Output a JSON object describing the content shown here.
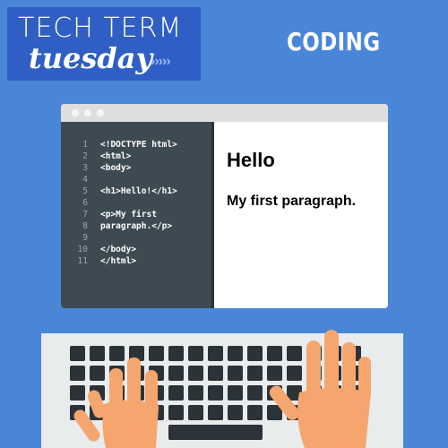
{
  "badge": {
    "line1": "TECH TERM",
    "line2": "tuesday",
    "arrows": "›››››"
  },
  "topic": "CODING",
  "window": {
    "code_lines": [
      {
        "num": "1",
        "text": "<!DOCTYPE html>"
      },
      {
        "num": "2",
        "text": "<html>"
      },
      {
        "num": "3",
        "text": "<body>"
      },
      {
        "num": "4",
        "text": ""
      },
      {
        "num": "5",
        "text": "<h1>Hello!</h1>"
      },
      {
        "num": "6",
        "text": ""
      },
      {
        "num": "7",
        "text": "<p>My first"
      },
      {
        "num": "8",
        "text": "paragraph.</p>"
      },
      {
        "num": "9",
        "text": ""
      },
      {
        "num": "10",
        "text": "</body>"
      },
      {
        "num": "11",
        "text": "</html>"
      }
    ],
    "preview_heading": "Hello",
    "preview_paragraph": "My first paragraph."
  },
  "colors": {
    "background": "#4a86d8",
    "badge": "#2f5fc4",
    "code_bg": "#3e4a51",
    "key": "#2b3338",
    "keyboard": "#e9eced",
    "skin": "#f5a66f"
  },
  "icons": [
    "window-dot-icon",
    "hand-icon",
    "keyboard-icon"
  ]
}
